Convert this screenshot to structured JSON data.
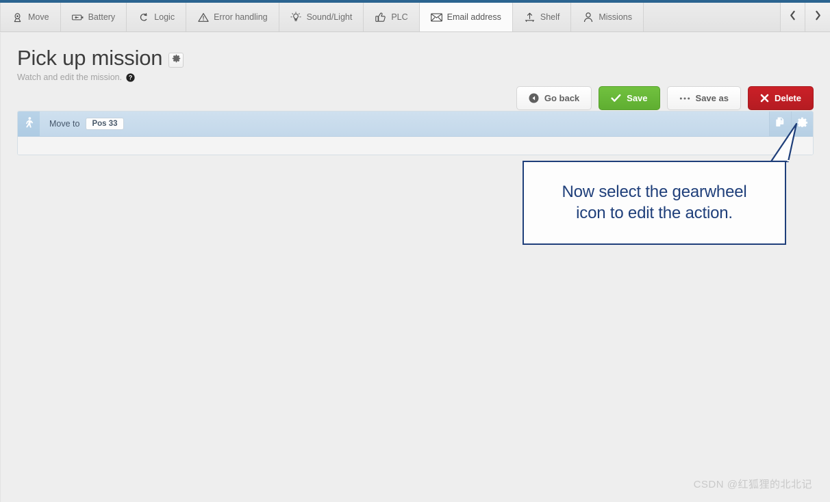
{
  "theme": {
    "rail_color": "#2b6490",
    "accent_blue": "#1f3f7a",
    "success_green": "#5fae31",
    "danger_red": "#cb2027",
    "row_blue": "#c3d8ea",
    "page_bg": "#eeeeee"
  },
  "tabbar": {
    "tabs": [
      {
        "label": "Move",
        "icon": "move-pin-icon",
        "active": false
      },
      {
        "label": "Battery",
        "icon": "battery-icon",
        "active": false
      },
      {
        "label": "Logic",
        "icon": "logic-loop-icon",
        "active": false
      },
      {
        "label": "Error handling",
        "icon": "warning-triangle-icon",
        "active": false
      },
      {
        "label": "Sound/Light",
        "icon": "lightbulb-icon",
        "active": false
      },
      {
        "label": "PLC",
        "icon": "thumbs-up-icon",
        "active": false
      },
      {
        "label": "Email address",
        "icon": "envelope-icon",
        "active": true
      },
      {
        "label": "Shelf",
        "icon": "upload-shelf-icon",
        "active": false
      },
      {
        "label": "Missions",
        "icon": "person-icon",
        "active": false
      }
    ],
    "nav_prev": "chevron-left-icon",
    "nav_next": "chevron-right-icon"
  },
  "header": {
    "title": "Pick up mission",
    "title_gear": "gear-icon",
    "subtitle": "Watch and edit the mission.",
    "help_icon": "help-circle-icon"
  },
  "actions": {
    "go_back": {
      "label": "Go back",
      "icon": "back-arrow-icon"
    },
    "save": {
      "label": "Save",
      "icon": "check-icon"
    },
    "save_as": {
      "label": "Save as",
      "icon": "ellipsis-icon"
    },
    "delete": {
      "label": "Delete",
      "icon": "cross-icon"
    }
  },
  "mission_actions": {
    "rows": [
      {
        "handle_icon": "walking-person-icon",
        "label": "Move to",
        "value": "Pos 33",
        "tools": [
          {
            "name": "duplicate-icon"
          },
          {
            "name": "gear-icon"
          }
        ]
      }
    ]
  },
  "callout": {
    "line1": "Now select the gearwheel",
    "line2": "icon to edit the action."
  },
  "watermark": {
    "text": "CSDN @红狐狸的北北记"
  }
}
